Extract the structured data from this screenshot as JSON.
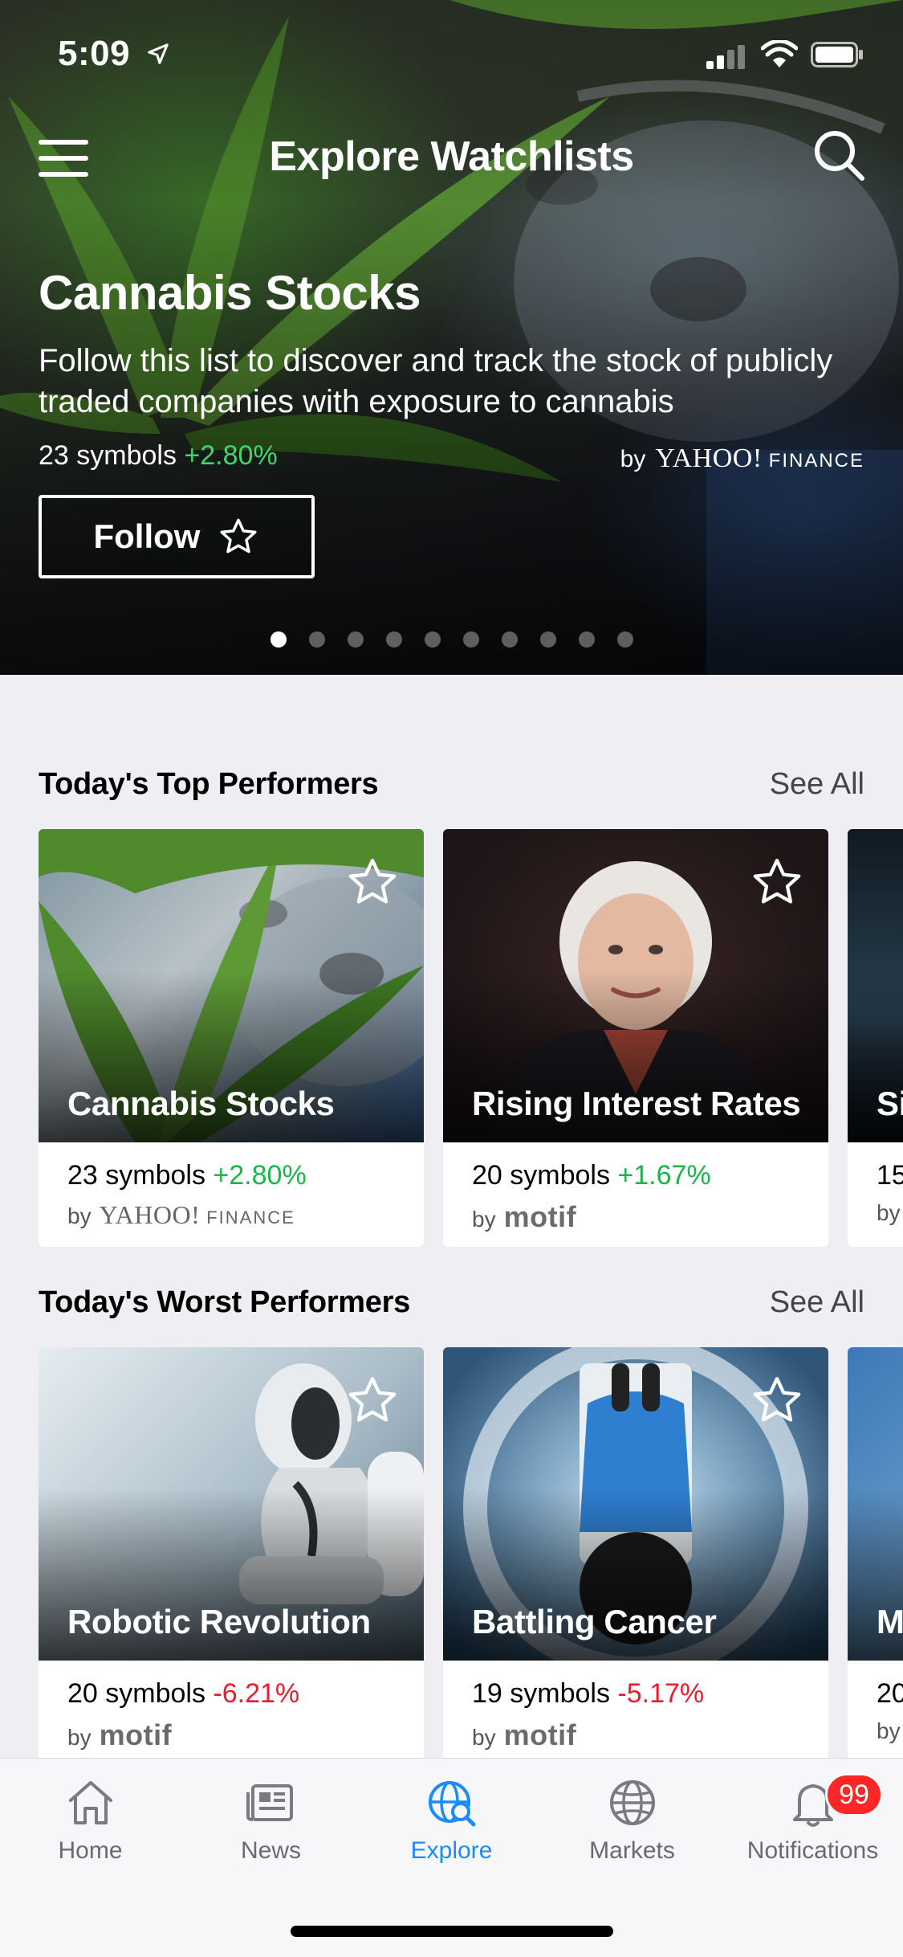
{
  "status_bar": {
    "time": "5:09"
  },
  "header": {
    "title": "Explore Watchlists"
  },
  "hero": {
    "title": "Cannabis Stocks",
    "description": "Follow this list to discover and track the stock of publicly traded companies with exposure to cannabis",
    "symbols": "23 symbols",
    "change": "+2.80%",
    "by": "by",
    "brand": "YAHOO!",
    "brand_sub": "FINANCE",
    "follow_label": "Follow",
    "page_count": 10,
    "page_active": 1
  },
  "top_performers": {
    "title": "Today's Top Performers",
    "see_all": "See All",
    "cards": [
      {
        "title": "Cannabis Stocks",
        "symbols": "23 symbols",
        "change": "+2.80%",
        "by": "by",
        "brand": "YAHOO!",
        "brand_sub": "FINANCE"
      },
      {
        "title": "Rising Interest Rates",
        "symbols": "20 symbols",
        "change": "+1.67%",
        "by": "by",
        "brand": "motif"
      },
      {
        "title": "Si",
        "symbols": "15",
        "by": "by"
      }
    ]
  },
  "worst_performers": {
    "title": "Today's Worst Performers",
    "see_all": "See All",
    "cards": [
      {
        "title": "Robotic Revolution",
        "symbols": "20 symbols",
        "change": "-6.21%",
        "by": "by",
        "brand": "motif"
      },
      {
        "title": "Battling Cancer",
        "symbols": "19 symbols",
        "change": "-5.17%",
        "by": "by",
        "brand": "motif"
      },
      {
        "title": "M",
        "symbols": "20",
        "by": "by"
      }
    ]
  },
  "tab_bar": {
    "tabs": [
      {
        "label": "Home",
        "icon": "home-icon"
      },
      {
        "label": "News",
        "icon": "news-icon"
      },
      {
        "label": "Explore",
        "icon": "explore-icon"
      },
      {
        "label": "Markets",
        "icon": "globe-icon"
      },
      {
        "label": "Notifications",
        "icon": "bell-icon"
      }
    ],
    "active": "Explore",
    "notification_badge": "99"
  },
  "colors": {
    "positive": "#19b648",
    "negative": "#ea1c2d",
    "accent": "#1a8cff",
    "badge": "#ff2626"
  }
}
